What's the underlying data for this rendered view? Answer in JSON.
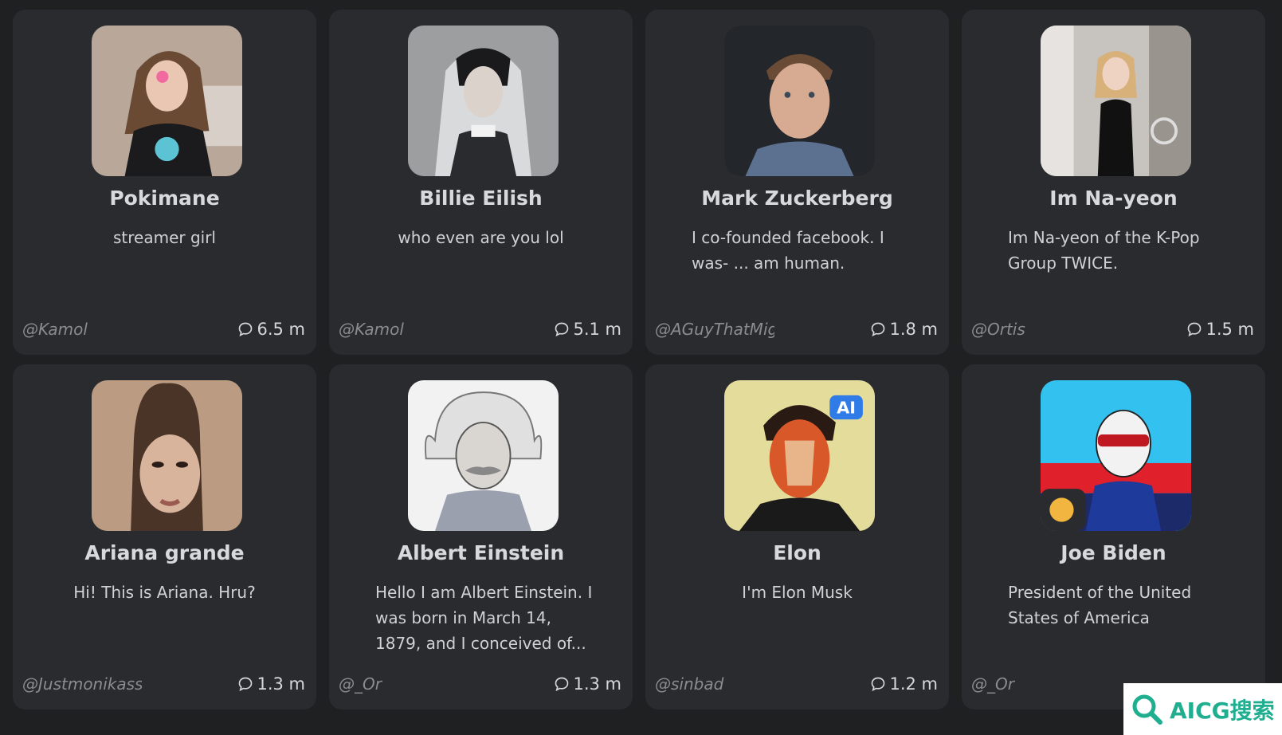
{
  "cards": [
    {
      "name": "Pokimane",
      "description": "streamer girl",
      "author": "@Kamol",
      "count": "6.5 m",
      "avatar_bg": "#b9a79a",
      "avatar_fg": "#3a2a20"
    },
    {
      "name": "Billie Eilish",
      "description": "who even are you lol",
      "author": "@Kamol",
      "count": "5.1 m",
      "avatar_bg": "#9c9ea0",
      "avatar_fg": "#2a2b2e"
    },
    {
      "name": "Mark Zuckerberg",
      "description": "I co-founded facebook. I was- ... am human.",
      "author": "@AGuyThatMigh",
      "count": "1.8 m",
      "avatar_bg": "#23262b",
      "avatar_fg": "#caa28c"
    },
    {
      "name": "Im Na-yeon",
      "description": "Im Na-yeon of the K-Pop Group TWICE.",
      "author": "@Ortis",
      "count": "1.5 m",
      "avatar_bg": "#c7c3bf",
      "avatar_fg": "#1a1a1a"
    },
    {
      "name": "Ariana grande",
      "description": "Hi! This is Ariana. Hru?",
      "author": "@Justmonikassis",
      "count": "1.3 m",
      "avatar_bg": "#bb9c82",
      "avatar_fg": "#4a3428"
    },
    {
      "name": "Albert Einstein",
      "description": "Hello I am Albert Einstein. I was born in March 14, 1879, and I conceived of...",
      "author": "@_Or",
      "count": "1.3 m",
      "avatar_bg": "#eeeeee",
      "avatar_fg": "#555a66"
    },
    {
      "name": "Elon",
      "description": "I'm Elon Musk",
      "author": "@sinbad",
      "count": "1.2 m",
      "avatar_bg": "#e4dc9a",
      "avatar_fg": "#d9582a",
      "badge": "AI"
    },
    {
      "name": "Joe Biden",
      "description": "President of the United States of America",
      "author": "@_Or",
      "count": "",
      "avatar_bg": "#33c2ef",
      "avatar_fg": "#e0202a"
    }
  ],
  "watermark": {
    "text": "AICG搜索"
  }
}
